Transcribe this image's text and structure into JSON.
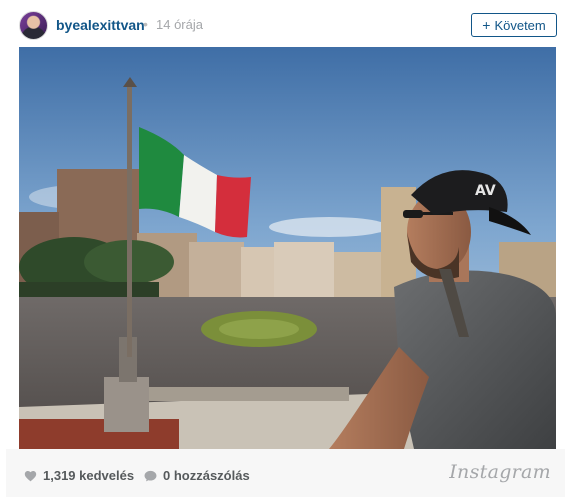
{
  "post": {
    "username": "byealexittvan",
    "separator": "•",
    "time_ago": "14 órája",
    "follow": {
      "icon": "plus-icon",
      "label": "Követem",
      "plus": "+"
    },
    "photo": {
      "cap_logo": "AV"
    },
    "likes": {
      "icon": "heart-icon",
      "text": "1,319 kedvelés"
    },
    "comments": {
      "icon": "comment-bubble-icon",
      "text": "0 hozzászólás"
    },
    "brand": "Instagram"
  },
  "colors": {
    "link_blue": "#125688",
    "muted_gray": "#a5a7aa",
    "stat_text": "#565a5c",
    "footer_bg": "#f7f7f7"
  }
}
